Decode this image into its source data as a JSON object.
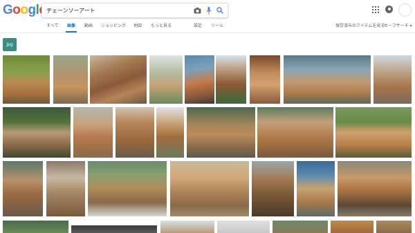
{
  "logo": {
    "letters": [
      "G",
      "o",
      "o",
      "g",
      "l",
      "e"
    ],
    "colors": [
      "#4285f4",
      "#ea4335",
      "#fbbc05",
      "#4285f4",
      "#34a853",
      "#ea4335"
    ]
  },
  "search": {
    "query": "チェーンソーアート"
  },
  "icons": {
    "camera": "camera-icon",
    "mic": "mic-icon",
    "search": "search-icon",
    "apps": "apps-grid-icon",
    "account": "account-icon"
  },
  "nav": {
    "all": "すべて",
    "images": "画像",
    "videos": "動画",
    "shopping": "ショッピング",
    "maps": "地図",
    "more": "もっと見る",
    "settings": "設定",
    "tools": "ツール",
    "saved": "保存済みのアイテムを見る",
    "safesearch": "セーフサーチ ▾"
  },
  "filter_chip": {
    "label": "jpg"
  },
  "colors": {
    "accent": "#1a73e8",
    "chip": "#3b8d81"
  }
}
